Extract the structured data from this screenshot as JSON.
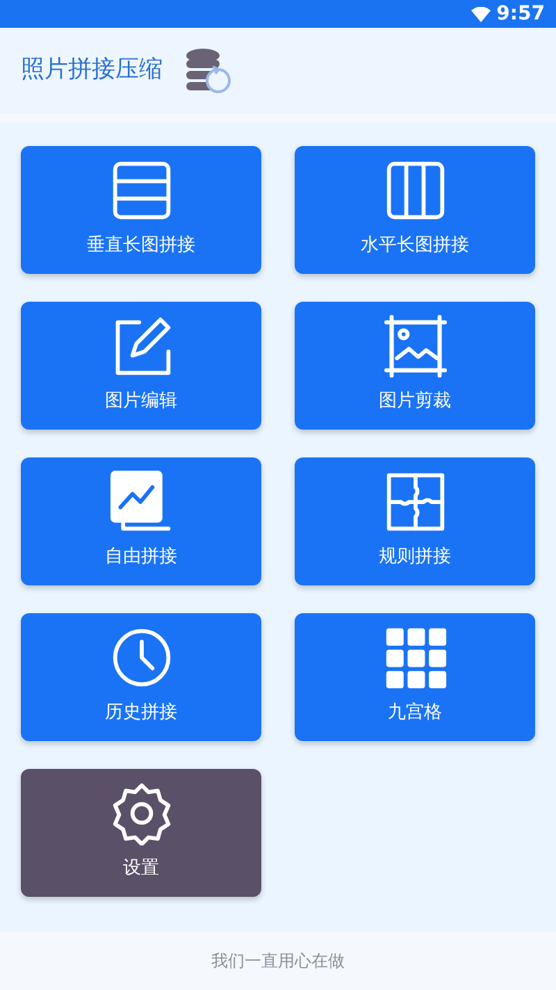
{
  "status_bar": {
    "time": "9:57"
  },
  "header": {
    "title": "照片拼接压缩"
  },
  "tiles": [
    {
      "label": "垂直长图拼接",
      "kind": "rows",
      "color": "#1a73f5"
    },
    {
      "label": "水平长图拼接",
      "kind": "columns",
      "color": "#1a73f5"
    },
    {
      "label": "图片编辑",
      "kind": "edit",
      "color": "#1a73f5"
    },
    {
      "label": "图片剪裁",
      "kind": "crop",
      "color": "#1a73f5"
    },
    {
      "label": "自由拼接",
      "kind": "gallery",
      "color": "#1a73f5"
    },
    {
      "label": "规则拼接",
      "kind": "puzzle",
      "color": "#1a73f5"
    },
    {
      "label": "历史拼接",
      "kind": "clock",
      "color": "#1a73f5"
    },
    {
      "label": "九宫格",
      "kind": "grid",
      "color": "#1a73f5"
    },
    {
      "label": "设置",
      "kind": "gear",
      "color": "#5a5068"
    }
  ],
  "footer": {
    "text": "我们一直用心在做"
  }
}
